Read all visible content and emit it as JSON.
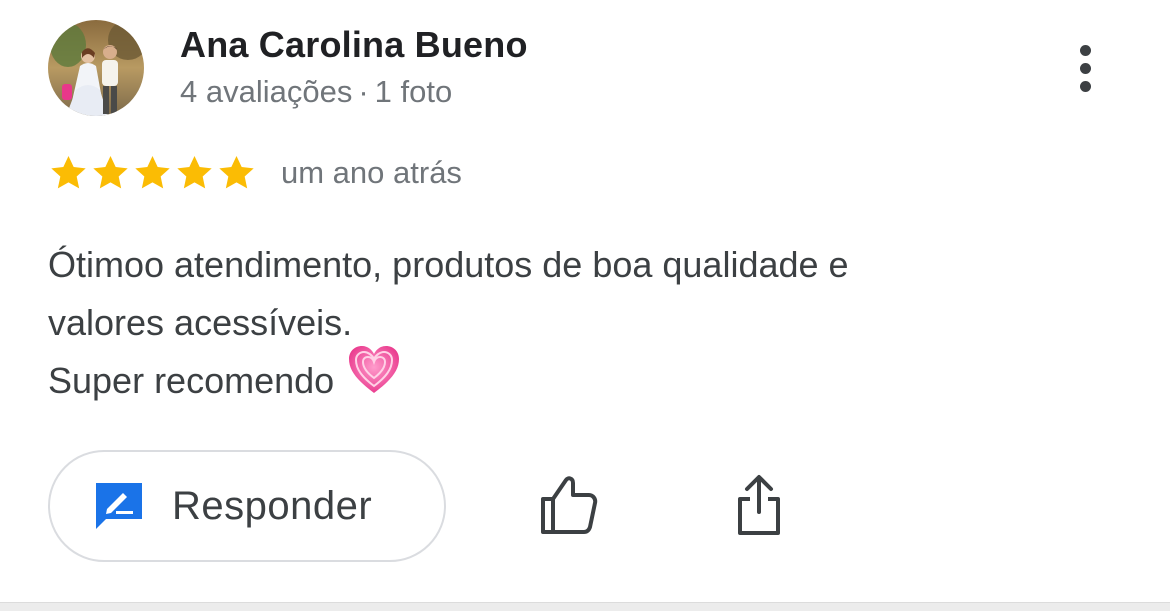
{
  "reviewer": {
    "name": "Ana Carolina Bueno",
    "reviews_count": "4 avaliações",
    "separator": "·",
    "photos_count": "1 foto"
  },
  "review": {
    "rating": 5,
    "max_rating": 5,
    "time": "um ano atrás",
    "text_lines": [
      "Ótimoo atendimento, produtos de boa qualidade e",
      "valores acessíveis.",
      "Super recomendo"
    ],
    "emoji": "growing-heart-emoji"
  },
  "actions": {
    "reply_label": "Responder",
    "like_icon": "thumbs-up-icon",
    "share_icon": "share-icon",
    "more_icon": "more-vert-icon"
  },
  "colors": {
    "star": "#fbbc04",
    "reply_icon": "#1a73e8",
    "name_text": "#202124",
    "meta_text": "#70757a",
    "body_text": "#3c4043",
    "button_border": "#dadce0"
  }
}
